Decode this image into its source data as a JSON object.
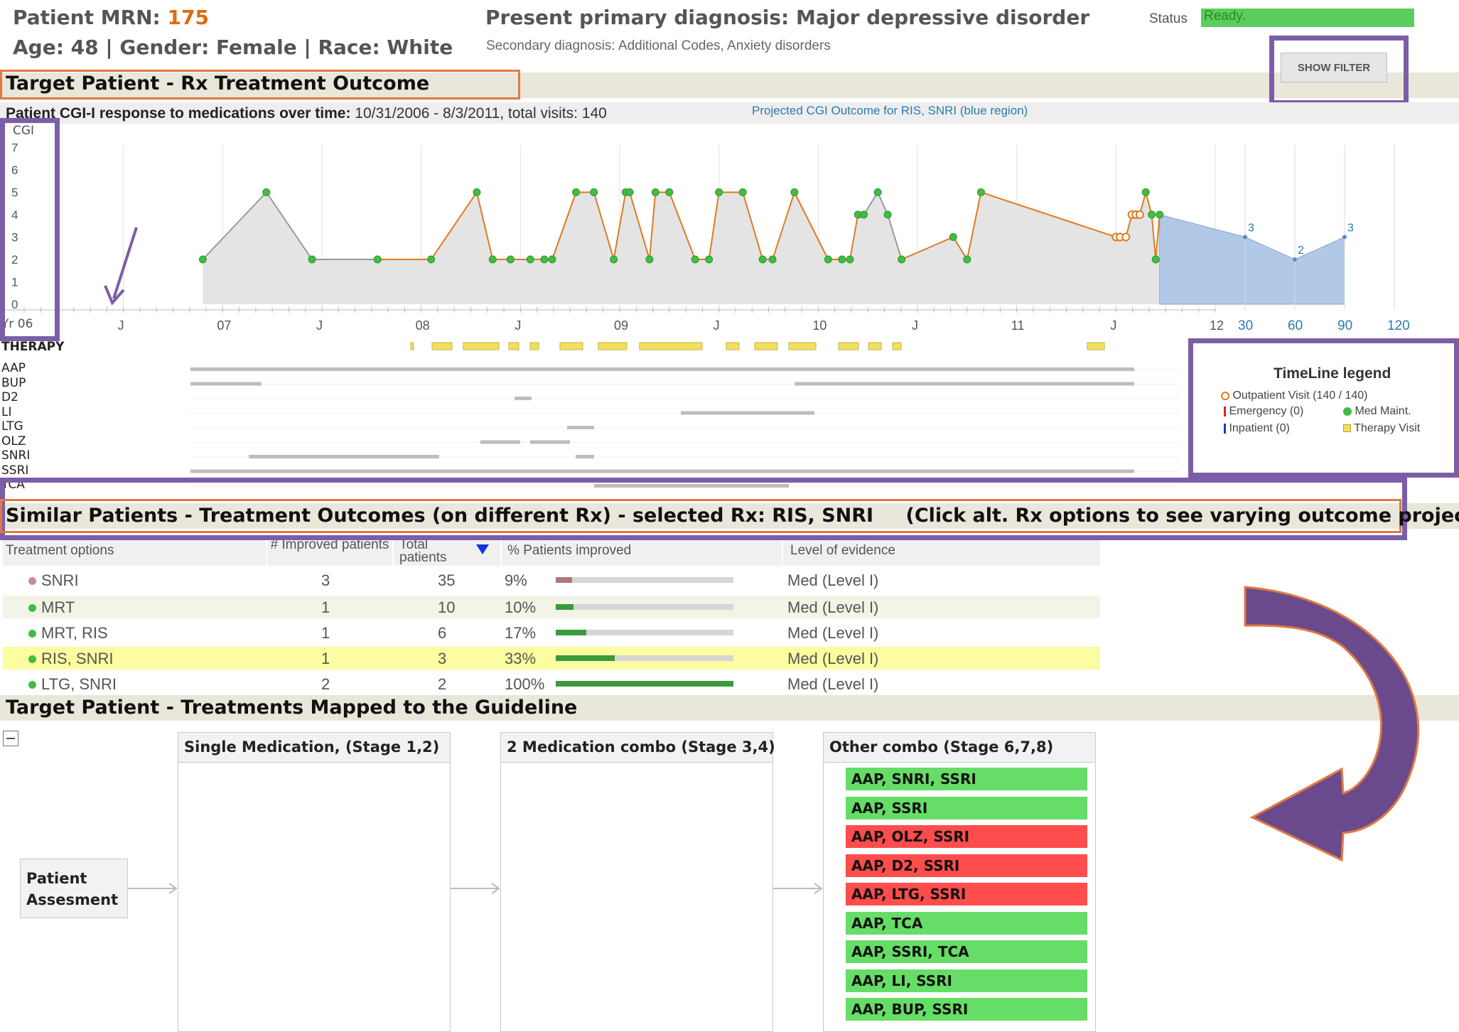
{
  "header": {
    "mrn_label": "Patient MRN:",
    "mrn_value": "175",
    "age": "Age: 48",
    "gender": "Gender: Female",
    "race": "Race: White",
    "separator": "|",
    "primary_diagnosis": "Present primary diagnosis: Major depressive disorder",
    "secondary_diagnosis": "Secondary diagnosis: Additional Codes, Anxiety disorders",
    "status_label": "Status",
    "status_value": "Ready."
  },
  "buttons": {
    "show_filter": "SHOW FILTER"
  },
  "sections": {
    "rx_outcome": "Target Patient - Rx Treatment Outcome",
    "similar": "Similar Patients - Treatment Outcomes (on different Rx) - selected Rx: RIS, SNRI",
    "similar_hint": "(Click alt. Rx options to see varying outcome projections)",
    "guideline": "Target Patient - Treatments Mapped to the Guideline"
  },
  "cgi_chart": {
    "title_bold": "Patient CGI-I response to medications over time:",
    "title_range": "10/31/2006 - 8/3/2011, total visits: 140",
    "projection_link": "Projected CGI Outcome for RIS, SNRI (blue region)",
    "y_axis_label": "CGI",
    "x_axis_label": "Yr 06",
    "therapy_label": "THERAPY"
  },
  "chart_data": {
    "type": "line",
    "title": "Patient CGI-I response to medications over time: 10/31/2006 - 8/3/2011, total visits: 140",
    "ylabel": "CGI",
    "ylim": [
      0,
      7
    ],
    "y_ticks": [
      "0",
      "1",
      "2",
      "3",
      "4",
      "5",
      "6",
      "7"
    ],
    "x_ticks": [
      "Yr 06",
      "J",
      "07",
      "J",
      "08",
      "J",
      "09",
      "J",
      "10",
      "J",
      "11",
      "J",
      "12"
    ],
    "projection_ticks": [
      "30",
      "60",
      "90",
      "120"
    ],
    "series": [
      {
        "name": "Outpatient Visit",
        "x": [
          2006.9,
          2007.22,
          2007.45,
          2007.78,
          2008.05,
          2008.28,
          2008.36,
          2008.45,
          2008.55,
          2008.62,
          2008.66,
          2008.78,
          2008.87,
          2008.97,
          2009.03,
          2009.05,
          2009.15,
          2009.18,
          2009.25,
          2009.38,
          2009.45,
          2009.5,
          2009.62,
          2009.72,
          2009.77,
          2009.88,
          2010.05,
          2010.12,
          2010.16,
          2010.2,
          2010.23,
          2010.3,
          2010.35,
          2010.42,
          2010.68,
          2010.75,
          2010.82,
          2011.5,
          2011.52,
          2011.55,
          2011.58,
          2011.6,
          2011.62,
          2011.65,
          2011.68,
          2011.7,
          2011.72
        ],
        "values": [
          2,
          5,
          2,
          2,
          2,
          5,
          2,
          2,
          2,
          2,
          2,
          5,
          5,
          2,
          5,
          5,
          2,
          5,
          5,
          2,
          2,
          5,
          5,
          2,
          2,
          5,
          2,
          2,
          2,
          4,
          4,
          5,
          4,
          2,
          3,
          2,
          5,
          3,
          3,
          3,
          4,
          4,
          4,
          5,
          4,
          2,
          4
        ]
      },
      {
        "name": "Projected",
        "x": [
          2011.72,
          30,
          60,
          90
        ],
        "values": [
          4,
          3,
          2,
          3
        ]
      }
    ],
    "projection_labels": [
      "3",
      "2",
      "3"
    ],
    "grid": true
  },
  "rx_rows": [
    "AAP",
    "BUP",
    "D2",
    "LI",
    "LTG",
    "OLZ",
    "SNRI",
    "SSRI",
    "TCA"
  ],
  "legend": {
    "title": "TimeLine legend",
    "outpatient": "Outpatient Visit (140 / 140)",
    "emergency": "Emergency (0)",
    "inpatient": "Inpatient (0)",
    "med_maint": "Med Maint.",
    "therapy": "Therapy Visit"
  },
  "table": {
    "headers": {
      "treatment": "Treatment options",
      "improved": "# Improved patients",
      "total": "Total patients",
      "pct": "% Patients improved",
      "evidence": "Level of evidence"
    },
    "rows": [
      {
        "name": "SNRI",
        "improved": "3",
        "total": "35",
        "pct": "9%",
        "pct_value": 0.09,
        "evidence": "Med (Level I)"
      },
      {
        "name": "MRT",
        "improved": "1",
        "total": "10",
        "pct": "10%",
        "pct_value": 0.1,
        "evidence": "Med (Level I)"
      },
      {
        "name": "MRT, RIS",
        "improved": "1",
        "total": "6",
        "pct": "17%",
        "pct_value": 0.17,
        "evidence": "Med (Level I)"
      },
      {
        "name": "RIS, SNRI",
        "improved": "1",
        "total": "3",
        "pct": "33%",
        "pct_value": 0.33,
        "evidence": "Med (Level I)"
      },
      {
        "name": "LTG, SNRI",
        "improved": "2",
        "total": "2",
        "pct": "100%",
        "pct_value": 1.0,
        "evidence": "Med (Level I)"
      }
    ]
  },
  "guideline": {
    "patient_box": "Patient Assesment",
    "col1": "Single Medication, (Stage 1,2)",
    "col2": "2 Medication combo (Stage 3,4)",
    "col3": "Other combo (Stage 6,7,8)",
    "combos": [
      {
        "label": "AAP, SNRI, SSRI",
        "status": "green"
      },
      {
        "label": "AAP, SSRI",
        "status": "green"
      },
      {
        "label": "AAP, OLZ, SSRI",
        "status": "red"
      },
      {
        "label": "AAP, D2, SSRI",
        "status": "red"
      },
      {
        "label": "AAP, LTG, SSRI",
        "status": "red"
      },
      {
        "label": "AAP, TCA",
        "status": "green"
      },
      {
        "label": "AAP, SSRI, TCA",
        "status": "green"
      },
      {
        "label": "AAP, LI, SSRI",
        "status": "green"
      },
      {
        "label": "AAP, BUP, SSRI",
        "status": "green"
      }
    ]
  },
  "colors": {
    "accent_purple": "#7b5ea7",
    "line_orange": "#e07a20",
    "point_green": "#44bb44",
    "projection_blue": "#a9c4e4",
    "row_highlight": "#fcfca0",
    "combo_green": "#66dd66",
    "combo_red": "#ff4c4c"
  }
}
